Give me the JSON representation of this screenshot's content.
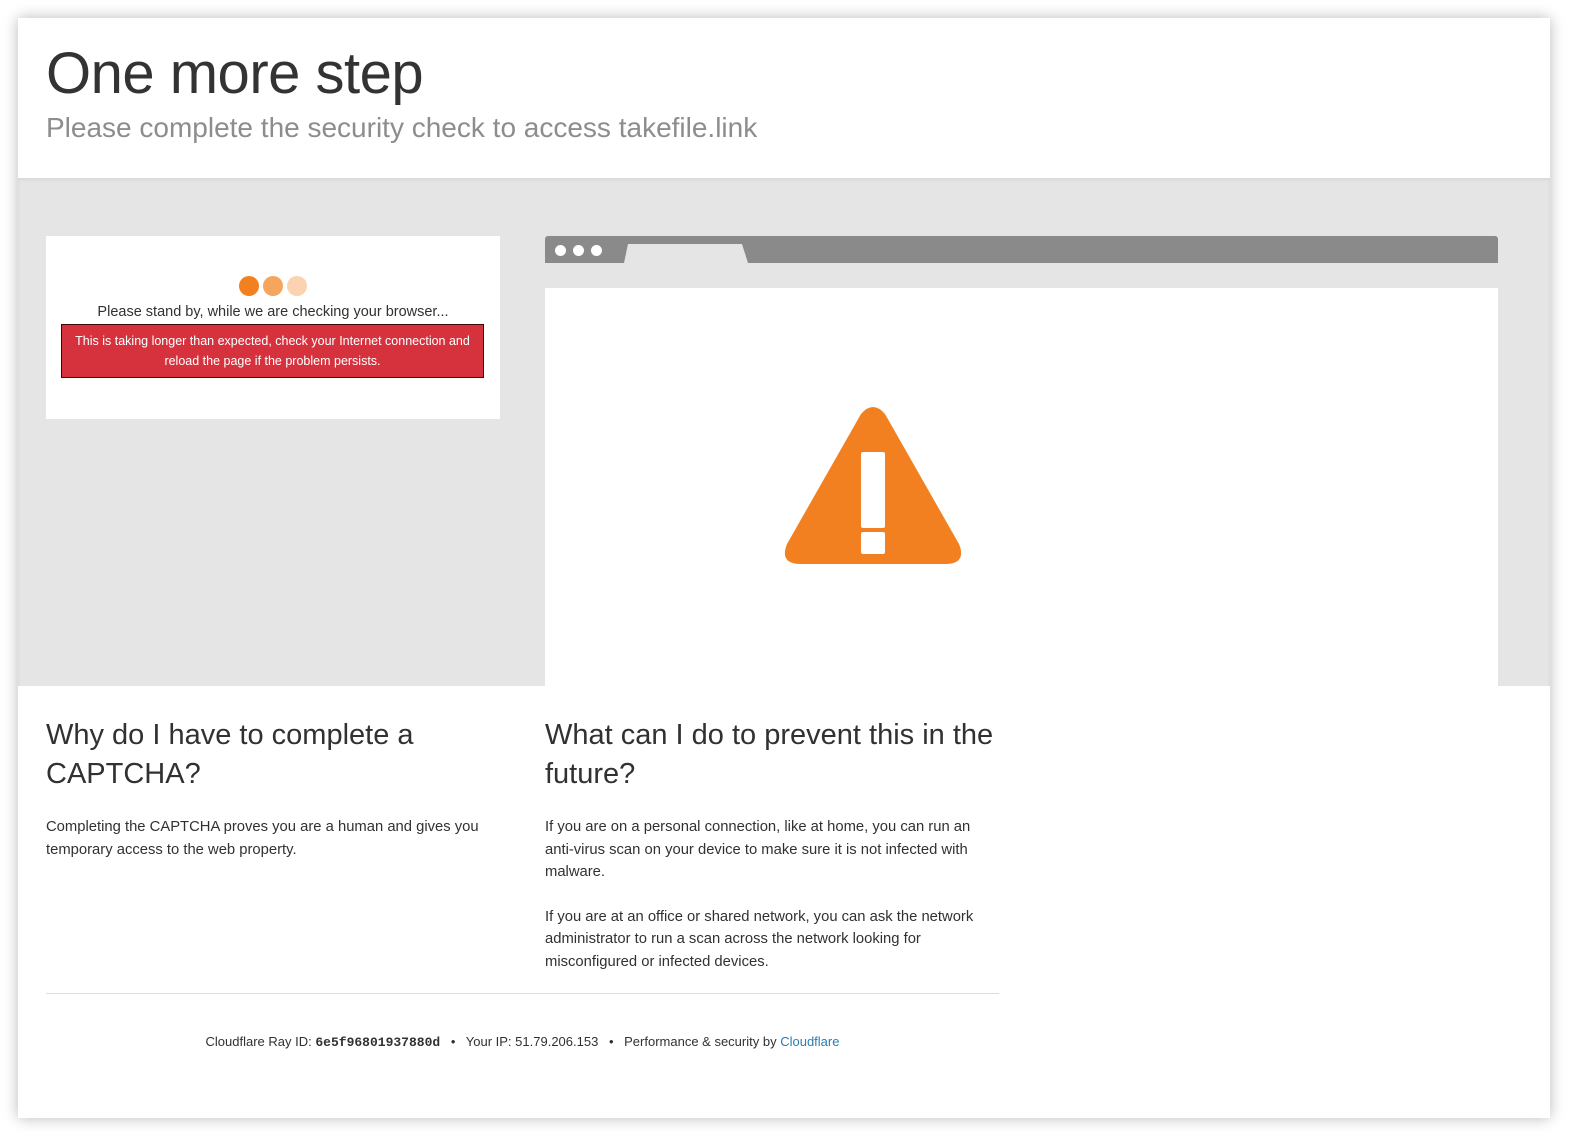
{
  "header": {
    "title": "One more step",
    "subtitle": "Please complete the security check to access takefile.link"
  },
  "check": {
    "standby_text": "Please stand by, while we are checking your browser...",
    "error_text": "This is taking longer than expected, check your Internet connection and reload the page if the problem persists.",
    "loader_dot_colors": [
      "#f38020",
      "#f6a55c",
      "#fbd3b0"
    ],
    "error_color": "#d6323e"
  },
  "illustration": {
    "icon": "warning-triangle-icon",
    "icon_color": "#f38020",
    "bar_color": "#8a8a8a"
  },
  "why": {
    "heading": "Why do I have to complete a CAPTCHA?",
    "body": "Completing the CAPTCHA proves you are a human and gives you temporary access to the web property."
  },
  "prevent": {
    "heading": "What can I do to prevent this in the future?",
    "paragraphs": [
      "If you are on a personal connection, like at home, you can run an anti-virus scan on your device to make sure it is not infected with malware.",
      "If you are at an office or shared network, you can ask the network administrator to run a scan across the network looking for misconfigured or infected devices."
    ]
  },
  "footer": {
    "ray_label": "Cloudflare Ray ID:",
    "ray_id": "6e5f96801937880d",
    "separator": "•",
    "ip_label": "Your IP:",
    "ip": "51.79.206.153",
    "perf_label": "Performance & security by",
    "cloudflare_link": "Cloudflare",
    "link_color": "#2c7cb0"
  }
}
